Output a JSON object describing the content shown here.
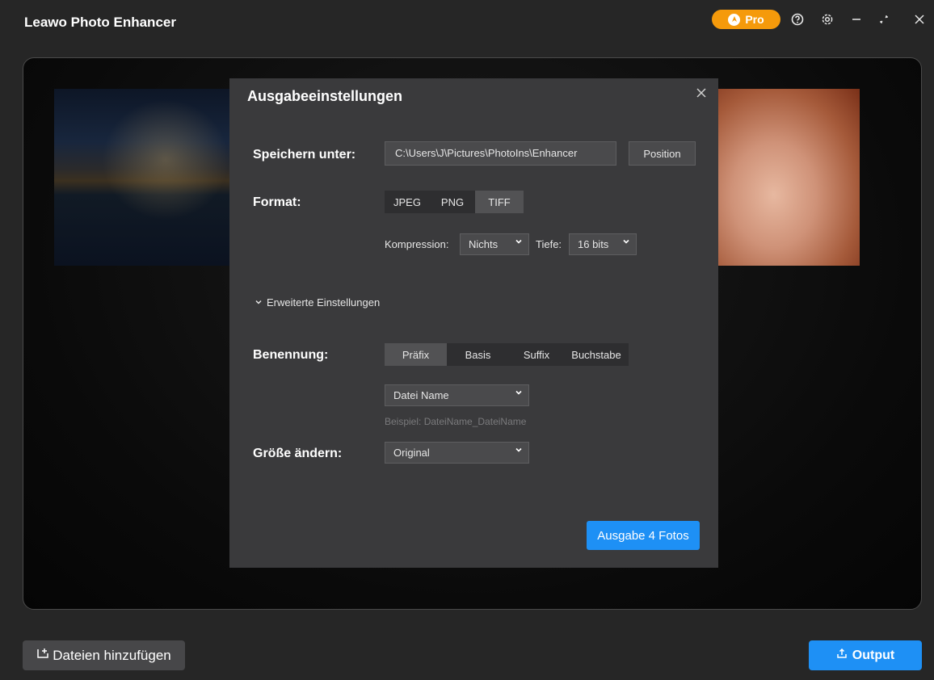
{
  "app": {
    "title": "Leawo Photo Enhancer"
  },
  "titlebar": {
    "pro_label": "Pro",
    "icons": [
      "help-icon",
      "settings-icon",
      "minimize-icon",
      "maximize-icon",
      "close-icon"
    ]
  },
  "dialog": {
    "title": "Ausgabeeinstellungen",
    "save_label": "Speichern unter:",
    "save_path": "C:\\Users\\J\\Pictures\\PhotoIns\\Enhancer",
    "position_button": "Position",
    "format_label": "Format:",
    "formats": [
      {
        "label": "JPEG",
        "active": false
      },
      {
        "label": "PNG",
        "active": false
      },
      {
        "label": "TIFF",
        "active": true
      }
    ],
    "compression_label": "Kompression:",
    "compression_value": "Nichts",
    "depth_label": "Tiefe:",
    "depth_value": "16 bits",
    "advanced_label": "Erweiterte Einstellungen",
    "naming_label": "Benennung:",
    "naming_options": [
      {
        "label": "Präfix",
        "active": true
      },
      {
        "label": "Basis",
        "active": false
      },
      {
        "label": "Suffix",
        "active": false
      },
      {
        "label": "Buchstabe",
        "active": false
      }
    ],
    "naming_value": "Datei Name",
    "example_text": "Beispiel: DateiName_DateiName",
    "resize_label": "Größe ändern:",
    "resize_value": "Original",
    "output_button": "Ausgabe 4 Fotos"
  },
  "bottom": {
    "add_files": "Dateien hinzufügen",
    "output": "Output"
  },
  "colors": {
    "accent": "#1e90f5",
    "pro": "#f59a0b",
    "dialog_bg": "#3a3a3c",
    "app_bg": "#262626"
  }
}
